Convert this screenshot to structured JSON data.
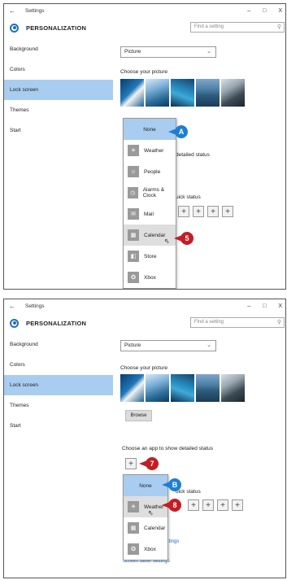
{
  "shots": [
    {
      "window": {
        "title": "Settings",
        "back": "←",
        "minimize": "–",
        "maximize": "□",
        "close": "X"
      },
      "header": {
        "title": "PERSONALIZATION",
        "search_placeholder": "Find a setting",
        "search_icon": "⚲"
      },
      "nav": [
        {
          "label": "Background",
          "active": false
        },
        {
          "label": "Colors",
          "active": false
        },
        {
          "label": "Lock screen",
          "active": true
        },
        {
          "label": "Themes",
          "active": false
        },
        {
          "label": "Start",
          "active": false
        }
      ],
      "content": {
        "background_value": "Picture",
        "choose_picture_label": "Choose your picture",
        "detailed_status_partial": "detailed status",
        "quick_status_partial": "uick status",
        "plus": "+"
      },
      "popup": [
        {
          "label": "None",
          "icon": "",
          "selected": true,
          "hover": false
        },
        {
          "label": "Weather",
          "icon": "☀",
          "selected": false,
          "hover": false
        },
        {
          "label": "People",
          "icon": "☺",
          "selected": false,
          "hover": false
        },
        {
          "label": "Alarms & Clock",
          "icon": "◷",
          "selected": false,
          "hover": false
        },
        {
          "label": "Mail",
          "icon": "✉",
          "selected": false,
          "hover": false
        },
        {
          "label": "Calendar",
          "icon": "▦",
          "selected": false,
          "hover": true
        },
        {
          "label": "Store",
          "icon": "◧",
          "selected": false,
          "hover": false
        },
        {
          "label": "Xbox",
          "icon": "✪",
          "selected": false,
          "hover": false
        }
      ],
      "callouts": {
        "a": "A",
        "five": "5"
      }
    },
    {
      "window": {
        "title": "Settings",
        "back": "←",
        "minimize": "–",
        "maximize": "□",
        "close": "X"
      },
      "header": {
        "title": "PERSONALIZATION",
        "search_placeholder": "Find a setting",
        "search_icon": "⚲"
      },
      "nav": [
        {
          "label": "Background",
          "active": false
        },
        {
          "label": "Colors",
          "active": false
        },
        {
          "label": "Lock screen",
          "active": true
        },
        {
          "label": "Themes",
          "active": false
        },
        {
          "label": "Start",
          "active": false
        }
      ],
      "content": {
        "background_value": "Picture",
        "choose_picture_label": "Choose your picture",
        "browse": "Browse",
        "detailed_status_label": "Choose an app to show detailed status",
        "quick_status_partial": "uick status",
        "plus": "+",
        "link_partial": "ttings",
        "screen_saver_link": "Screen saver settings"
      },
      "popup": [
        {
          "label": "None",
          "icon": "",
          "selected": true,
          "hover": false
        },
        {
          "label": "Weather",
          "icon": "☀",
          "selected": false,
          "hover": true
        },
        {
          "label": "Calendar",
          "icon": "▦",
          "selected": false,
          "hover": false
        },
        {
          "label": "Xbox",
          "icon": "✪",
          "selected": false,
          "hover": false
        }
      ],
      "callouts": {
        "b": "B",
        "seven": "7",
        "eight": "8"
      }
    }
  ]
}
